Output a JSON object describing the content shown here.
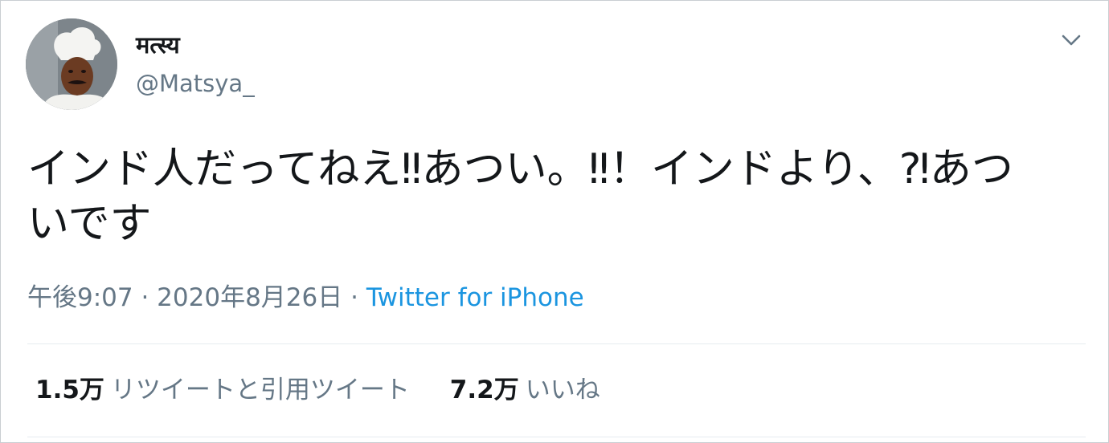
{
  "tweet": {
    "author": {
      "display_name": "मत्स्य",
      "handle": "@Matsya_"
    },
    "text_line1": "インド人だってねえ‼あつい。‼！インドより、⁈あつ",
    "text_line2": "いです",
    "timestamp": "午後9:07 · 2020年8月26日",
    "separator": " · ",
    "source": "Twitter for iPhone",
    "stats": {
      "retweets_count": "1.5万",
      "retweets_label": "リツイートと引用ツイート",
      "likes_count": "7.2万",
      "likes_label": "いいね"
    },
    "icons": {
      "menu": "chevron-down-icon"
    },
    "colors": {
      "link": "#1b95e0",
      "secondary_text": "#657786",
      "primary_text": "#14171a"
    }
  }
}
